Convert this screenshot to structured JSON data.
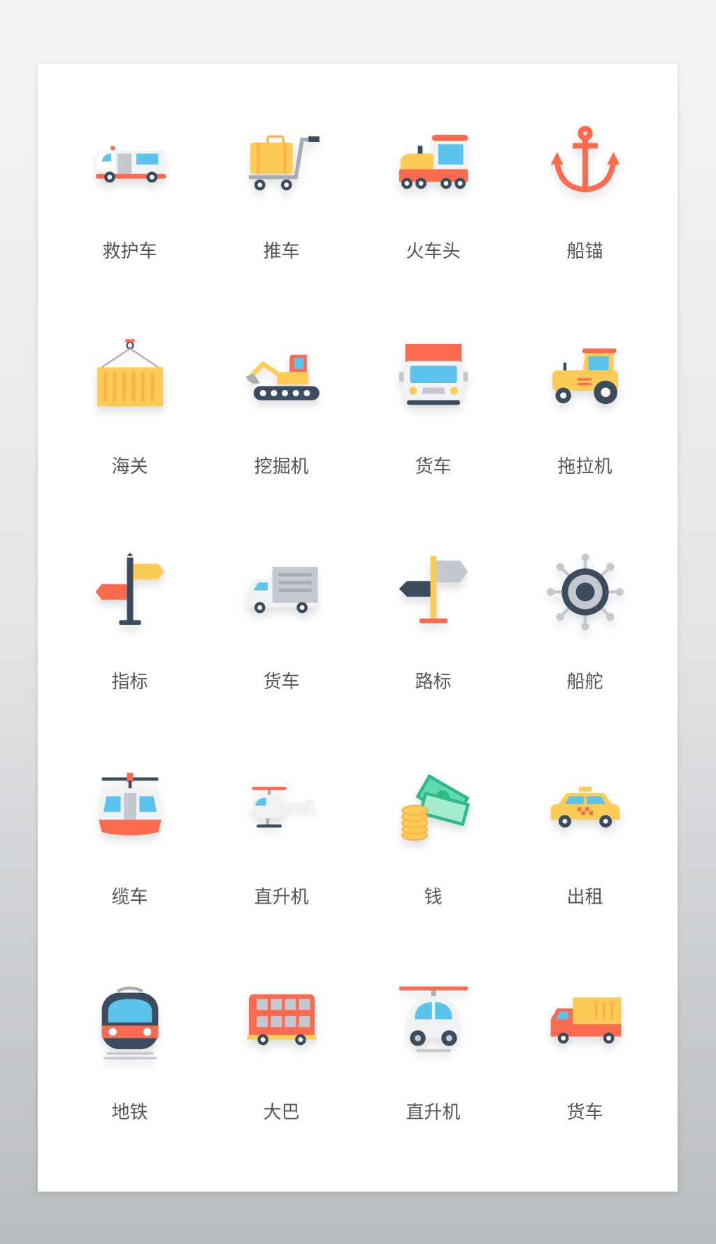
{
  "colors": {
    "red": "#fc6a4f",
    "yellow": "#fdcc56",
    "dark": "#3b4c5e",
    "blue": "#5bc3ec",
    "gray": "#c4c9d1",
    "label": "#555555"
  },
  "items": [
    {
      "label": "救护车",
      "icon": "ambulance-icon"
    },
    {
      "label": "推车",
      "icon": "luggage-cart-icon"
    },
    {
      "label": "火车头",
      "icon": "locomotive-icon"
    },
    {
      "label": "船锚",
      "icon": "anchor-icon"
    },
    {
      "label": "海关",
      "icon": "cargo-container-icon"
    },
    {
      "label": "挖掘机",
      "icon": "excavator-icon"
    },
    {
      "label": "货车",
      "icon": "truck-front-icon"
    },
    {
      "label": "拖拉机",
      "icon": "tractor-icon"
    },
    {
      "label": "指标",
      "icon": "signpost-icon"
    },
    {
      "label": "货车",
      "icon": "delivery-truck-icon"
    },
    {
      "label": "路标",
      "icon": "road-sign-icon"
    },
    {
      "label": "船舵",
      "icon": "ship-wheel-icon"
    },
    {
      "label": "缆车",
      "icon": "cable-car-icon"
    },
    {
      "label": "直升机",
      "icon": "helicopter-icon"
    },
    {
      "label": "钱",
      "icon": "money-icon"
    },
    {
      "label": "出租",
      "icon": "taxi-icon"
    },
    {
      "label": "地铁",
      "icon": "subway-icon"
    },
    {
      "label": "大巴",
      "icon": "double-decker-bus-icon"
    },
    {
      "label": "直升机",
      "icon": "helicopter-front-icon"
    },
    {
      "label": "货车",
      "icon": "dump-truck-icon"
    }
  ]
}
